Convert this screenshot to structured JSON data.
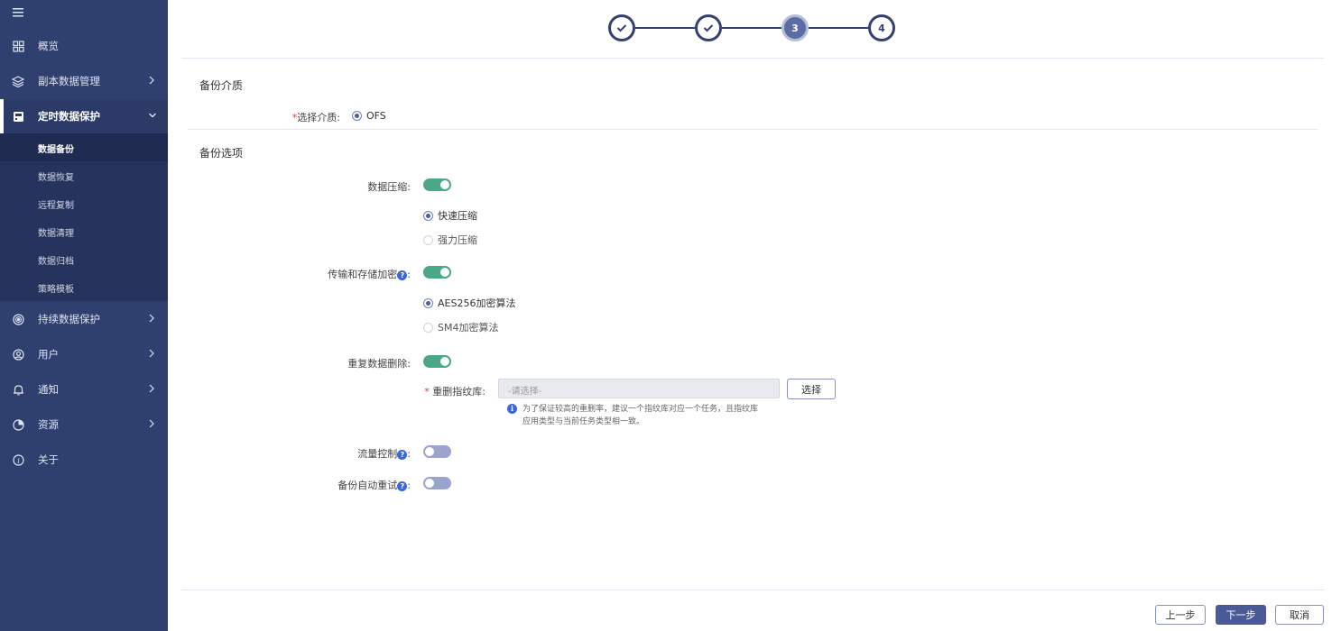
{
  "sidebar": {
    "menu_icon": "hamburger-icon",
    "items": [
      {
        "label": "概览",
        "icon": "grid-icon",
        "has_chevron": false
      },
      {
        "label": "副本数据管理",
        "icon": "copy-data-icon",
        "has_chevron": true
      },
      {
        "label": "定时数据保护",
        "icon": "scheduled-protect-icon",
        "has_chevron": true,
        "expanded": true
      },
      {
        "label": "持续数据保护",
        "icon": "continuous-protect-icon",
        "has_chevron": true
      },
      {
        "label": "用户",
        "icon": "user-icon",
        "has_chevron": true
      },
      {
        "label": "通知",
        "icon": "bell-icon",
        "has_chevron": true
      },
      {
        "label": "资源",
        "icon": "pie-icon",
        "has_chevron": true
      },
      {
        "label": "关于",
        "icon": "info-icon",
        "has_chevron": false
      }
    ],
    "submenu": [
      "数据备份",
      "数据恢复",
      "远程复制",
      "数据清理",
      "数据归档",
      "策略模板"
    ],
    "active_submenu": "数据备份"
  },
  "stepper": {
    "steps": [
      "✓",
      "✓",
      "3",
      "4"
    ],
    "current": 3
  },
  "media_section": {
    "title": "备份介质",
    "select_label": "选择介质:",
    "option": "OFS"
  },
  "options_section": {
    "title": "备份选项",
    "compression": {
      "label": "数据压缩:",
      "enabled": true,
      "options": [
        "快速压缩",
        "强力压缩"
      ],
      "selected": "快速压缩"
    },
    "encryption": {
      "label": "传输和存储加密",
      "enabled": true,
      "options": [
        "AES256加密算法",
        "SM4加密算法"
      ],
      "selected": "AES256加密算法"
    },
    "dedup": {
      "label": "重复数据删除:",
      "enabled": true,
      "fingerprint_label": "重删指纹库:",
      "placeholder": "-请选择-",
      "select_button": "选择",
      "hint_line1": "为了保证较高的重删率，建议一个指纹库对应一个任务，且指纹库",
      "hint_line2": "应用类型与当前任务类型相一致。"
    },
    "flow_control": {
      "label": "流量控制",
      "enabled": false
    },
    "auto_retry": {
      "label": "备份自动重试",
      "enabled": false
    }
  },
  "footer": {
    "prev": "上一步",
    "next": "下一步",
    "cancel": "取消"
  },
  "colors": {
    "sidebar_bg": "#2f3f6e",
    "accent": "#4a5a96",
    "switch_on": "#4aa789",
    "switch_off": "#9aa4cf"
  }
}
